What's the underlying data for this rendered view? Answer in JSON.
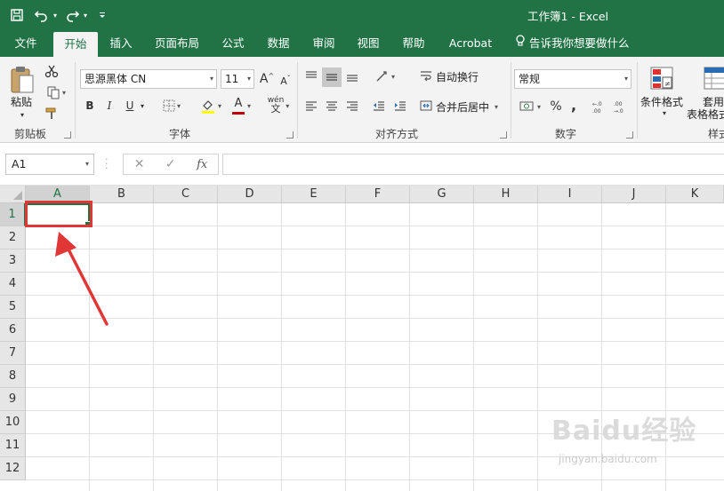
{
  "window": {
    "title": "工作簿1  -  Excel"
  },
  "quick_access": {
    "save_icon": "save-icon",
    "undo_icon": "undo-icon",
    "redo_icon": "redo-icon",
    "customize_icon": "chevron-down-icon"
  },
  "tabs": [
    {
      "label": "文件"
    },
    {
      "label": "开始"
    },
    {
      "label": "插入"
    },
    {
      "label": "页面布局"
    },
    {
      "label": "公式"
    },
    {
      "label": "数据"
    },
    {
      "label": "审阅"
    },
    {
      "label": "视图"
    },
    {
      "label": "帮助"
    },
    {
      "label": "Acrobat"
    }
  ],
  "tell_me": "告诉我你想要做什么",
  "ribbon": {
    "clipboard": {
      "paste_label": "粘贴",
      "group_label": "剪贴板"
    },
    "font": {
      "font_name": "思源黑体 CN",
      "font_size": "11",
      "bold": "B",
      "italic": "I",
      "underline": "U",
      "grow": "A",
      "shrink": "A",
      "font_color_letter": "A",
      "phonetic": "wén",
      "group_label": "字体"
    },
    "alignment": {
      "wrap_text": "自动换行",
      "merge_center": "合并后居中",
      "group_label": "对齐方式"
    },
    "number": {
      "format": "常规",
      "percent": "%",
      "comma": ",",
      "group_label": "数字"
    },
    "styles": {
      "conditional_format": "条件格式",
      "table_format_1": "套用",
      "table_format_2": "表格格式",
      "group_label": "样式"
    }
  },
  "formula_bar": {
    "name_box": "A1",
    "cancel": "✕",
    "enter": "✓",
    "fx": "fx",
    "formula": ""
  },
  "sheet": {
    "columns": [
      "A",
      "B",
      "C",
      "D",
      "E",
      "F",
      "G",
      "H",
      "I",
      "J",
      "K"
    ],
    "rows": [
      "1",
      "2",
      "3",
      "4",
      "5",
      "6",
      "7",
      "8",
      "9",
      "10",
      "11",
      "12"
    ],
    "active_cell": "A1"
  },
  "colors": {
    "brand": "#217346",
    "annotation": "#e03636"
  },
  "watermark": {
    "text": "Baidu经验",
    "url_text": "jingyan.baidu.com"
  }
}
